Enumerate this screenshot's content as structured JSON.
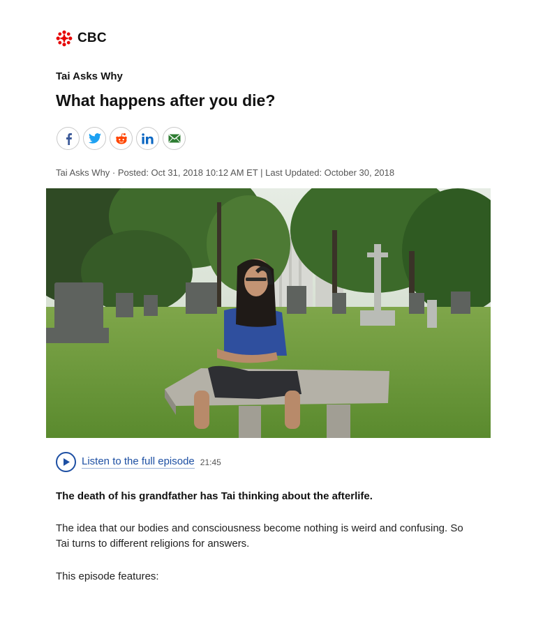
{
  "brand": {
    "name": "CBC",
    "color": "#e60505"
  },
  "show_name": "Tai Asks Why",
  "article": {
    "title": "What happens after you die?",
    "meta": "Tai Asks Why · Posted: Oct 31, 2018 10:12 AM ET | Last Updated: October 30, 2018"
  },
  "share": [
    {
      "icon": "facebook-icon",
      "color": "#3b5998"
    },
    {
      "icon": "twitter-icon",
      "color": "#1da1f2"
    },
    {
      "icon": "reddit-icon",
      "color": "#ff4500"
    },
    {
      "icon": "linkedin-icon",
      "color": "#0a66c2"
    },
    {
      "icon": "email-icon",
      "color": "#2e7d32"
    }
  ],
  "audio": {
    "link_label": "Listen to the full episode",
    "duration": "21:45",
    "accent": "#1d4fa3"
  },
  "body": {
    "lead": "The death of his grandfather has Tai thinking about the afterlife.",
    "paragraph": "The idea that our bodies and consciousness become nothing is weird and confusing. So Tai turns to different religions for answers.",
    "features_label": "This episode features:"
  }
}
